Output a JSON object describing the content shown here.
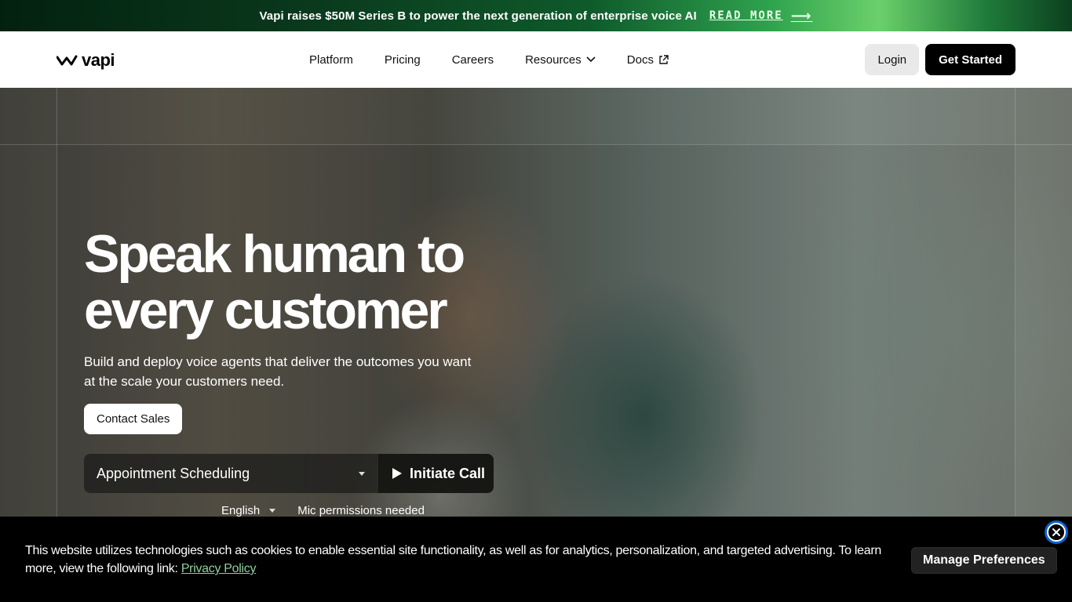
{
  "announcement": {
    "text": "Vapi raises $50M Series B to power the next generation of enterprise voice AI",
    "link_label": "READ MORE"
  },
  "nav": {
    "logo_text": "vapi",
    "links": [
      {
        "label": "Platform"
      },
      {
        "label": "Pricing"
      },
      {
        "label": "Careers"
      },
      {
        "label": "Resources"
      },
      {
        "label": "Docs"
      }
    ],
    "login_label": "Login",
    "get_started_label": "Get Started"
  },
  "hero": {
    "headline_line1": "Speak human to",
    "headline_line2": "every customer",
    "subhead": "Build and deploy voice agents that deliver the outcomes you want at the scale your customers need.",
    "contact_label": "Contact Sales",
    "use_case_selected": "Appointment Scheduling",
    "initiate_label": "Initiate Call",
    "language_selected": "English",
    "mic_status": "Mic permissions needed"
  },
  "cookie": {
    "text": "This website utilizes technologies such as cookies to enable essential site functionality, as well as for analytics, personalization, and targeted advertising. To learn more, view the following link:",
    "link_label": "Privacy Policy",
    "manage_label": "Manage Preferences"
  },
  "colors": {
    "brand_black": "#000000",
    "announce_green": "#2fa34e",
    "close_ring": "#0b63ce",
    "link_green": "#8fd0a0"
  }
}
